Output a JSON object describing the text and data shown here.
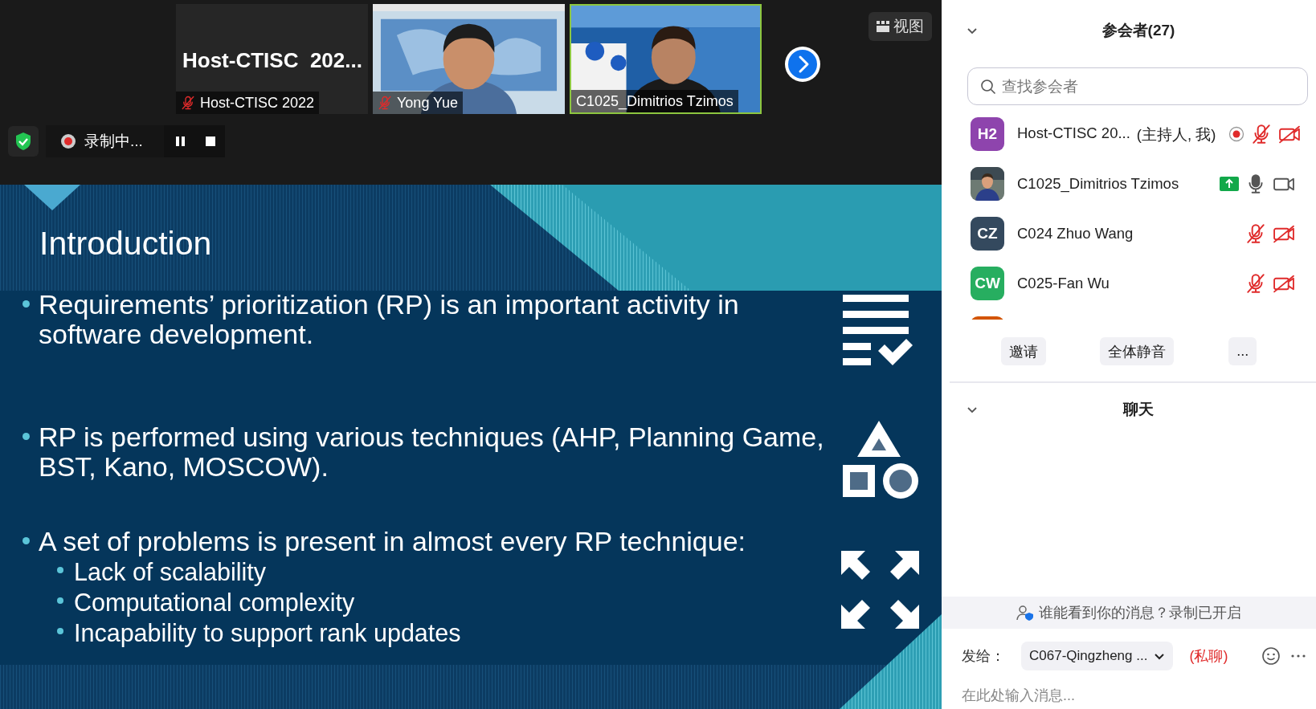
{
  "video_strip": {
    "tiles": [
      {
        "kind": "name",
        "display_name": "Host-CTISC  202...",
        "label": "Host-CTISC 2022",
        "muted": true,
        "active": false
      },
      {
        "kind": "video",
        "label": "Yong Yue",
        "muted": true,
        "active": false
      },
      {
        "kind": "video",
        "label": "C1025_Dimitrios Tzimos",
        "muted": false,
        "active": true
      }
    ],
    "view_button": "视图"
  },
  "recording": {
    "label": "录制中..."
  },
  "slide": {
    "title": "Introduction",
    "bullets": [
      {
        "text": "Requirements’ prioritization (RP) is an important activity in software development."
      },
      {
        "text": "RP is performed using various techniques (AHP, Planning Game, BST, Kano, MOSCOW)."
      },
      {
        "text": "A set of problems is present in almost every RP technique:",
        "children": [
          {
            "text": "Lack of scalability"
          },
          {
            "text": "Computational complexity"
          },
          {
            "text": "Incapability to support rank updates"
          }
        ]
      }
    ]
  },
  "participants": {
    "title": "参会者(27)",
    "expanded": true,
    "search": {
      "placeholder": "查找参会者"
    },
    "items": [
      {
        "name": "Host-CTISC 20...",
        "tag": "(主持人, 我)",
        "avatar": {
          "kind": "initials",
          "text": "H2",
          "color": "#8e44ad"
        },
        "recording": true,
        "sharing": false,
        "mic_muted": true,
        "video_off": true
      },
      {
        "name": "C1025_Dimitrios Tzimos",
        "recording": false,
        "sharing": true,
        "mic_muted": false,
        "video_off": false
      },
      {
        "name": "C024 Zhuo Wang",
        "avatar": {
          "kind": "initials",
          "text": "CZ",
          "color": "#34495e"
        },
        "recording": false,
        "sharing": false,
        "mic_muted": true,
        "video_off": true
      },
      {
        "name": "C025-Fan Wu",
        "avatar": {
          "kind": "initials",
          "text": "CW",
          "color": "#27ae60"
        },
        "recording": false,
        "sharing": false,
        "mic_muted": true,
        "video_off": true
      },
      {
        "avatar": {
          "kind": "blank",
          "color": "#d35400"
        }
      }
    ],
    "buttons": [
      "邀请",
      "全体静音",
      "..."
    ]
  },
  "chat": {
    "title": "聊天",
    "expanded": true,
    "notice": "谁能看到你的消息？录制已开启",
    "to_label": "发给：",
    "recipient": "C067-Qingzheng ...",
    "private_label": "(私聊)",
    "input": {
      "placeholder": "在此处输入消息..."
    }
  }
}
